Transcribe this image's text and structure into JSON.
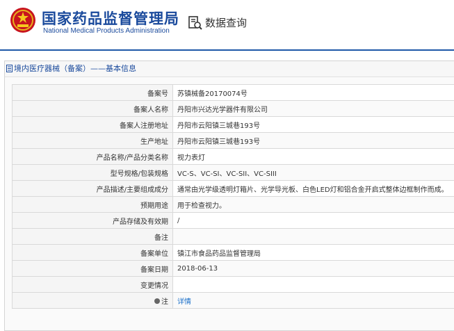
{
  "header": {
    "org_name_cn": "国家药品监督管理局",
    "org_name_en": "National Medical Products Administration",
    "query_title": "数据查询",
    "emblem_icon": "national-emblem-icon",
    "query_icon": "document-search-icon"
  },
  "section": {
    "title": "境内医疗器械（备案）——基本信息",
    "icon": "document-icon"
  },
  "rows": [
    {
      "label": "备案号",
      "value": "苏镇械备20170074号"
    },
    {
      "label": "备案人名称",
      "value": "丹阳市兴达光学器件有限公司"
    },
    {
      "label": "备案人注册地址",
      "value": "丹阳市云阳镇三城巷193号"
    },
    {
      "label": "生产地址",
      "value": "丹阳市云阳镇三城巷193号"
    },
    {
      "label": "产品名称/产品分类名称",
      "value": "视力表灯"
    },
    {
      "label": "型号规格/包装规格",
      "value": "VC-S、VC-SI、VC-SII、VC-SIII"
    },
    {
      "label": "产品描述/主要组成成分",
      "value": "通常由光学级透明灯箱片、光学导光板、白色LED灯和铝合金开启式整体边框制作而成。"
    },
    {
      "label": "预期用途",
      "value": "用于检查视力。"
    },
    {
      "label": "产品存储及有效期",
      "value": "/"
    },
    {
      "label": "备注",
      "value": ""
    },
    {
      "label": "备案单位",
      "value": "镇江市食品药品监督管理局"
    },
    {
      "label": "备案日期",
      "value": "2018-06-13"
    },
    {
      "label": "变更情况",
      "value": ""
    }
  ],
  "note_row": {
    "label": "注",
    "link": "详情",
    "icon": "pin-icon"
  },
  "colors": {
    "brand": "#1a4a9c",
    "rule": "#1e57a8",
    "link": "#1a6fc9"
  }
}
